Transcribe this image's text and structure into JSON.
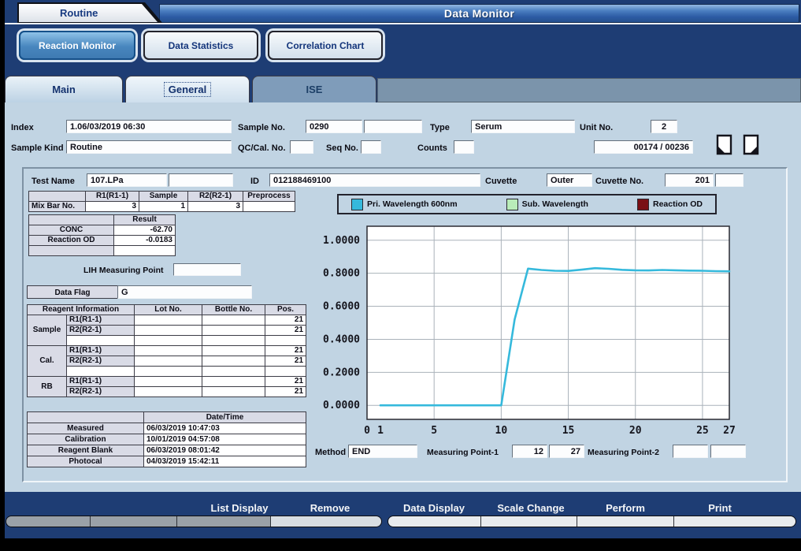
{
  "titlebar": {
    "routine": "Routine",
    "title": "Data Monitor"
  },
  "toolbar": {
    "reaction_monitor": "Reaction Monitor",
    "data_statistics": "Data Statistics",
    "correlation_chart": "Correlation Chart"
  },
  "tabs": {
    "main": "Main",
    "general": "General",
    "ise": "ISE"
  },
  "header": {
    "index_label": "Index",
    "index_value": "1.06/03/2019 06:30",
    "sample_no_label": "Sample No.",
    "sample_no": "0290",
    "sample_no2": "",
    "type_label": "Type",
    "type": "Serum",
    "unit_no_label": "Unit No.",
    "unit_no": "2",
    "sample_kind_label": "Sample Kind",
    "sample_kind": "Routine",
    "qc_cal_no_label": "QC/Cal. No.",
    "qc_cal_no": "",
    "seq_no_label": "Seq No.",
    "seq_no": "",
    "counts_label": "Counts",
    "counts": "",
    "counter": "00174 / 00236"
  },
  "test": {
    "test_name_label": "Test Name",
    "test_name": "107.LPa",
    "test_name2": "",
    "id_label": "ID",
    "id": "012188469100",
    "cuvette_label": "Cuvette",
    "cuvette": "Outer",
    "cuvette_no_label": "Cuvette No.",
    "cuvette_no": "201",
    "cuvette_no2": ""
  },
  "mix_bar": {
    "label": "Mix Bar No.",
    "columns": [
      "R1(R1-1)",
      "Sample",
      "R2(R2-1)",
      "Preprocess"
    ],
    "values": [
      "3",
      "1",
      "3",
      ""
    ]
  },
  "result": {
    "header": "Result",
    "rows": [
      {
        "label": "CONC",
        "value": "-62.70"
      },
      {
        "label": "Reaction OD",
        "value": "-0.0183"
      },
      {
        "label": "",
        "value": ""
      }
    ]
  },
  "lih": {
    "label": "LIH Measuring Point",
    "value": ""
  },
  "data_flag": {
    "label": "Data Flag",
    "value": "G"
  },
  "reagent": {
    "header": "Reagent Information",
    "columns": [
      "Lot No.",
      "Bottle No.",
      "Pos."
    ],
    "groups": [
      {
        "name": "Sample",
        "rows": [
          {
            "label": "R1(R1-1)",
            "lot": "",
            "bottle": "",
            "pos": "21"
          },
          {
            "label": "R2(R2-1)",
            "lot": "",
            "bottle": "",
            "pos": "21"
          },
          {
            "label": "",
            "lot": "",
            "bottle": "",
            "pos": ""
          }
        ]
      },
      {
        "name": "Cal.",
        "rows": [
          {
            "label": "R1(R1-1)",
            "lot": "",
            "bottle": "",
            "pos": "21"
          },
          {
            "label": "R2(R2-1)",
            "lot": "",
            "bottle": "",
            "pos": "21"
          },
          {
            "label": "",
            "lot": "",
            "bottle": "",
            "pos": ""
          }
        ]
      },
      {
        "name": "RB",
        "rows": [
          {
            "label": "R1(R1-1)",
            "lot": "",
            "bottle": "",
            "pos": "21"
          },
          {
            "label": "R2(R2-1)",
            "lot": "",
            "bottle": "",
            "pos": "21"
          }
        ]
      }
    ]
  },
  "datetime": {
    "header": "Date/Time",
    "rows": [
      {
        "label": "Measured",
        "value": "06/03/2019 10:47:03"
      },
      {
        "label": "Calibration",
        "value": "10/01/2019 04:57:08"
      },
      {
        "label": "Reagent Blank",
        "value": "06/03/2019 08:01:42"
      },
      {
        "label": "Photocal",
        "value": "04/03/2019 15:42:11"
      }
    ]
  },
  "chart_data": {
    "type": "line",
    "title": "",
    "legend": [
      {
        "label": "Pri. Wavelength 600nm",
        "color": "#35b9dc"
      },
      {
        "label": "Sub. Wavelength",
        "color": "#b9ecb9"
      },
      {
        "label": "Reaction OD",
        "color": "#7a1016"
      }
    ],
    "legend_position": "top",
    "grid": true,
    "x": [
      1,
      2,
      3,
      4,
      5,
      6,
      7,
      8,
      9,
      10,
      11,
      12,
      13,
      14,
      15,
      16,
      17,
      18,
      19,
      20,
      21,
      22,
      23,
      24,
      25,
      26,
      27
    ],
    "series": [
      {
        "name": "Pri. Wavelength 600nm",
        "color": "#35b9dc",
        "values": [
          0,
          0,
          0,
          0,
          0,
          0,
          0,
          0,
          0,
          0,
          0.52,
          0.828,
          0.82,
          0.815,
          0.814,
          0.822,
          0.831,
          0.827,
          0.821,
          0.818,
          0.817,
          0.82,
          0.818,
          0.816,
          0.815,
          0.813,
          0.812
        ]
      }
    ],
    "xlim": [
      0,
      27
    ],
    "ylim": [
      -0.085,
      1.085
    ],
    "y_ticks": [
      1.0,
      0.8,
      0.6,
      0.4,
      0.2,
      0.0
    ],
    "y_tick_labels": [
      "1.0000",
      "0.8000",
      "0.6000",
      "0.4000",
      "0.2000",
      "0.0000"
    ],
    "x_ticks": [
      0,
      1,
      5,
      10,
      15,
      20,
      25,
      27
    ],
    "grid_x": [
      5,
      10,
      15,
      20,
      25
    ],
    "grid_y": [
      0.0,
      0.2,
      0.4,
      0.6,
      0.8,
      1.0
    ]
  },
  "method": {
    "label": "Method",
    "value": "END"
  },
  "mp1": {
    "label": "Measuring Point-1",
    "v1": "12",
    "v2": "27"
  },
  "mp2": {
    "label": "Measuring Point-2",
    "v1": "",
    "v2": ""
  },
  "bottom": {
    "list_display": "List Display",
    "remove": "Remove",
    "data_display": "Data Display",
    "scale_change": "Scale Change",
    "perform": "Perform",
    "print": "Print"
  }
}
